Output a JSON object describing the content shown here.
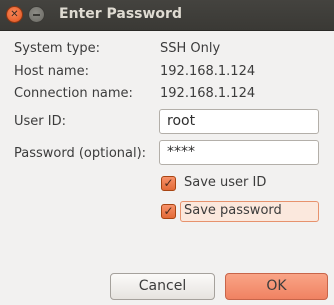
{
  "window": {
    "title": "Enter Password"
  },
  "info": {
    "system_type_label": "System type:",
    "system_type_value": "SSH Only",
    "host_name_label": "Host name:",
    "host_name_value": "192.168.1.124",
    "connection_name_label": "Connection name:",
    "connection_name_value": "192.168.1.124"
  },
  "form": {
    "user_id_label": "User ID:",
    "user_id_value": "root",
    "password_label": "Password (optional):",
    "password_value": "****",
    "save_user_id_label": "Save user ID",
    "save_user_id_checked": true,
    "save_password_label": "Save password",
    "save_password_checked": true
  },
  "buttons": {
    "cancel": "Cancel",
    "ok": "OK"
  },
  "colors": {
    "accent": "#f08262",
    "titlebar": "#3c3b37",
    "background": "#f2f1f0"
  }
}
